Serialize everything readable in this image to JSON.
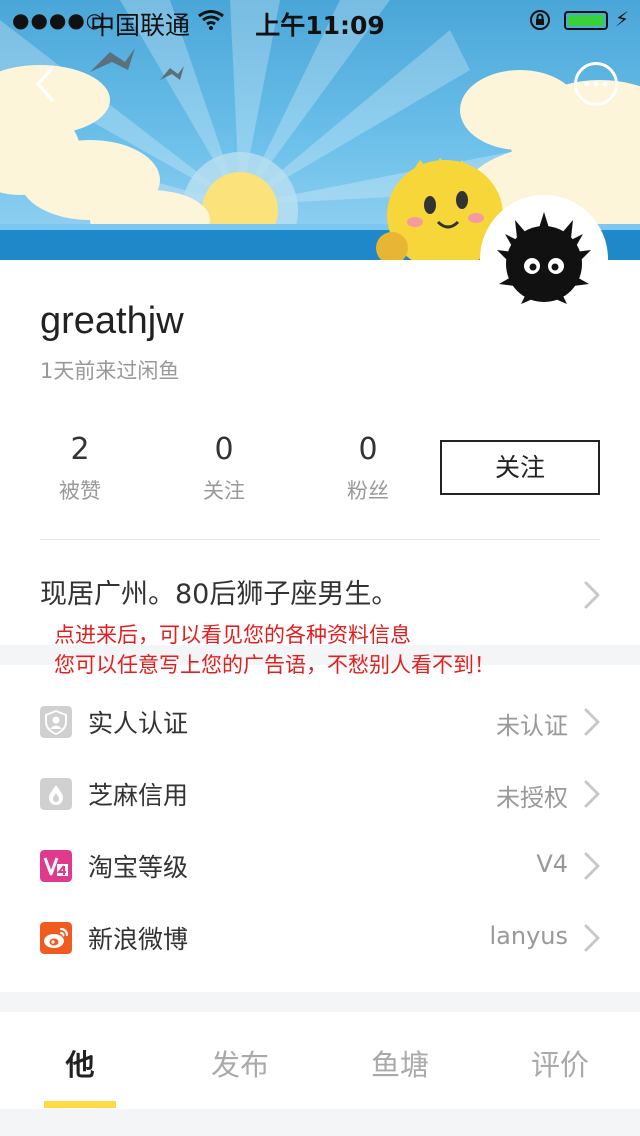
{
  "status_bar": {
    "signal": "●●●●○",
    "carrier": "中国联通",
    "time": "上午11:09"
  },
  "header": {
    "back_icon": "chevron-left-icon",
    "more_icon": "more-dots-icon"
  },
  "profile": {
    "username": "greathjw",
    "last_seen": "1天前来过闲鱼",
    "stats": [
      {
        "value": "2",
        "label": "被赞"
      },
      {
        "value": "0",
        "label": "关注"
      },
      {
        "value": "0",
        "label": "粉丝"
      }
    ],
    "follow_label": "关注",
    "bio": "现居广州。80后狮子座男生。"
  },
  "annotation": {
    "line1": "点进来后，可以看见您的各种资料信息",
    "line2": "您可以任意写上您的广告语，不愁别人看不到！",
    "color": "#e21f1f"
  },
  "info_list": [
    {
      "icon": "verified-person-icon",
      "label": "实人认证",
      "value": "未认证",
      "icon_color": "#c8c8c8"
    },
    {
      "icon": "sesame-credit-icon",
      "label": "芝麻信用",
      "value": "未授权",
      "icon_color": "#c8c8c8"
    },
    {
      "icon": "taobao-level-icon",
      "label": "淘宝等级",
      "value": "V4",
      "icon_color": "#e03a8d"
    },
    {
      "icon": "weibo-icon",
      "label": "新浪微博",
      "value": "lanyus",
      "icon_color": "#f25b1f"
    }
  ],
  "tabs": [
    {
      "label": "他",
      "active": true
    },
    {
      "label": "发布",
      "active": false
    },
    {
      "label": "鱼塘",
      "active": false
    },
    {
      "label": "评价",
      "active": false
    }
  ],
  "colors": {
    "accent_yellow": "#ffda44",
    "battery_green": "#38d13a"
  }
}
